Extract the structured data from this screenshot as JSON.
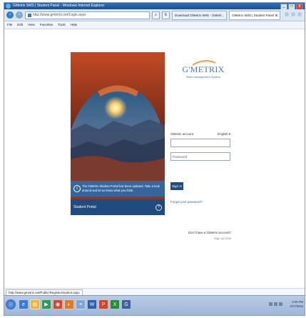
{
  "window": {
    "title": "GMetrix SMS | Student Panel - Windows Internet Explorer",
    "controls": {
      "minimize": "_",
      "maximize": "□",
      "close": "X"
    }
  },
  "nav": {
    "address": "http://www.gmetrix.net/Login.aspx",
    "search_icon": "search-icon",
    "tabs": [
      {
        "label": "Download GMetrix SMS - GMetri..."
      },
      {
        "label": "GMetrix SMS | Student Panel",
        "close": "X"
      }
    ]
  },
  "menu": {
    "items": [
      "File",
      "Edit",
      "View",
      "Favorites",
      "Tools",
      "Help"
    ]
  },
  "hero": {
    "notice": "The GMetrix Student Portal has been updated. Take a look around and let us know what you think.",
    "footer": "Student Portal",
    "help": "?"
  },
  "login": {
    "brand": "G'METRIX",
    "subtitle": "Skills Management System",
    "account_label": "GMetrix account",
    "language": "English ▾",
    "username_placeholder": "",
    "password_placeholder": "Password",
    "signin": "Sign in",
    "forgot": "Forgot your password?",
    "no_account": "Don't have a GMetrix account?",
    "signup": "Sign up now"
  },
  "status": {
    "url": "http://www.gmetrix.net/Public/RegisterStudent.aspx"
  },
  "taskbar": {
    "apps": [
      {
        "icon": "ie-icon",
        "glyph": "e"
      },
      {
        "icon": "folder-icon",
        "glyph": "▤"
      },
      {
        "icon": "media-icon",
        "glyph": "▶"
      },
      {
        "icon": "office-icon",
        "glyph": "◉"
      },
      {
        "icon": "firefox-icon",
        "glyph": "◐"
      },
      {
        "icon": "notepad-icon",
        "glyph": "≡"
      },
      {
        "icon": "word-icon",
        "glyph": "W"
      },
      {
        "icon": "powerpoint-icon",
        "glyph": "P"
      },
      {
        "icon": "excel-icon",
        "glyph": "X"
      },
      {
        "icon": "gmetrix-icon",
        "glyph": "G"
      }
    ],
    "clock": {
      "time": "2:08 PM",
      "date": "4/17/2016"
    }
  }
}
